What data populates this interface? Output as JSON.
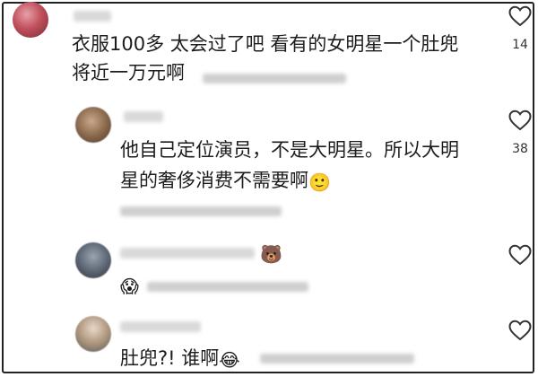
{
  "comments": [
    {
      "lines": [
        "衣服100多 太会过了吧 看有的女明星一个肚兜",
        "将近一万元啊"
      ],
      "like_count": "14"
    },
    {
      "lines": [
        "他自己定位演员，不是大明星。所以大明",
        "星的奢侈消费不需要啊"
      ],
      "emoji": "🙂",
      "like_count": "38"
    },
    {
      "reply_emoji": "😱",
      "name_emoji": "🐻",
      "like_count": ""
    },
    {
      "text": "肚兜?! 谁啊",
      "emoji": "😂",
      "like_count": ""
    }
  ],
  "icons": {
    "heart": "heart-outline-icon"
  },
  "colors": {
    "text": "#1c1c1c",
    "blur": "#d9d9d9",
    "border": "#222222"
  }
}
